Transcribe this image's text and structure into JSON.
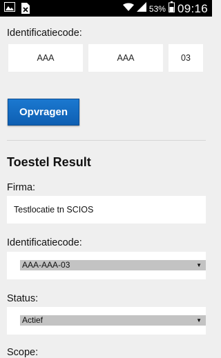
{
  "statusbar": {
    "battery_percent": "53%",
    "time": "09:16",
    "icons": [
      "image-icon",
      "sim-blocked-icon",
      "wifi-icon",
      "signal-icon",
      "battery-icon"
    ]
  },
  "form": {
    "id_label": "Identificatiecode:",
    "code_part1": "AAA",
    "code_part2": "AAA",
    "code_part3": "03",
    "submit_label": "Opvragen"
  },
  "result": {
    "title": "Toestel Result",
    "firma_label": "Firma:",
    "firma_value": "Testlocatie tn SCIOS",
    "id_label": "Identificatiecode:",
    "id_selected": "AAA-AAA-03",
    "status_label": "Status:",
    "status_selected": "Actief",
    "scope_label": "Scope:"
  },
  "colors": {
    "background": "#efefef",
    "button": "#1569c2",
    "select": "#c3c3c3"
  }
}
